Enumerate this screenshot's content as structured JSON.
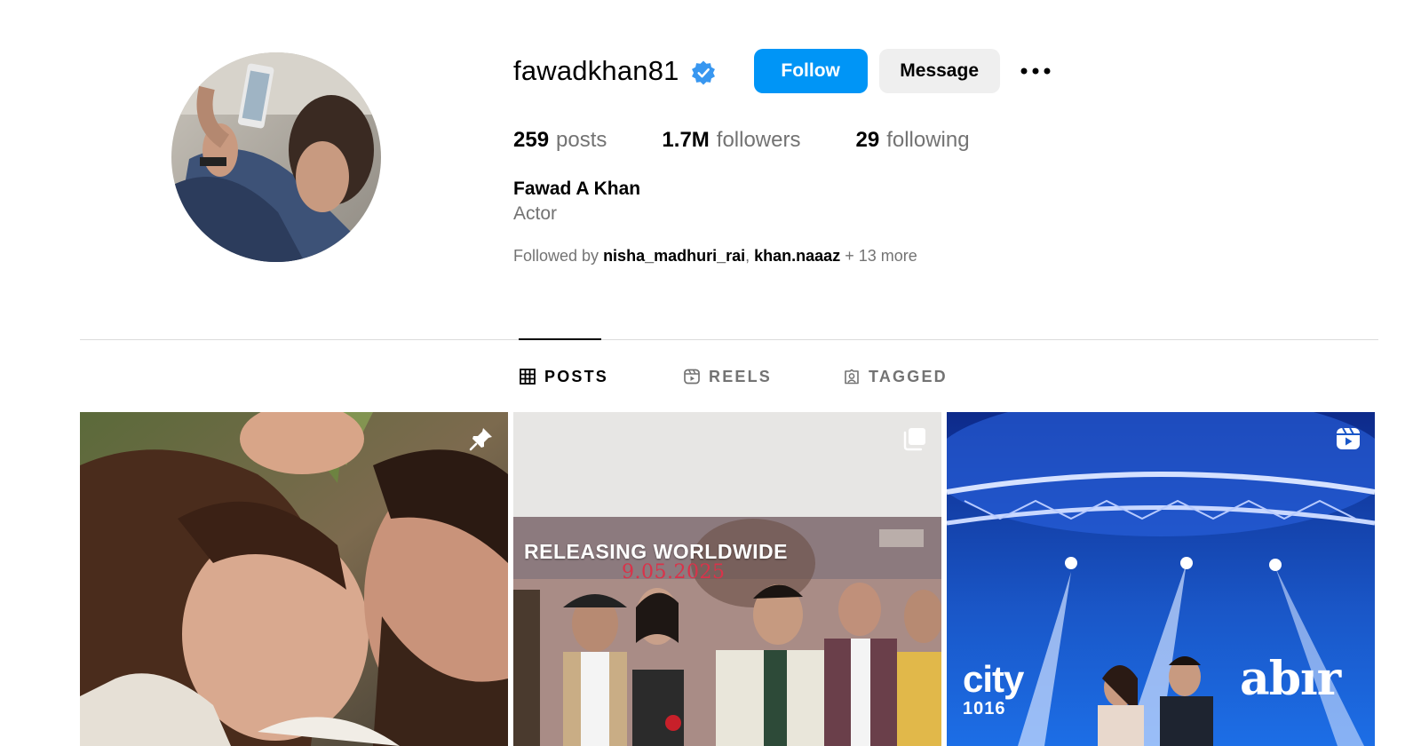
{
  "profile": {
    "username": "fawadkhan81",
    "verified": true,
    "follow_label": "Follow",
    "message_label": "Message",
    "stats": {
      "posts_count": "259",
      "posts_label": "posts",
      "followers_count": "1.7M",
      "followers_label": "followers",
      "following_count": "29",
      "following_label": "following"
    },
    "full_name": "Fawad A Khan",
    "category": "Actor",
    "followed_by": {
      "prefix": "Followed by",
      "user1": "nisha_madhuri_rai",
      "separator": ",",
      "user2": "khan.naaaz",
      "more": "+ 13 more"
    }
  },
  "tabs": [
    {
      "label": "POSTS",
      "icon": "grid-icon",
      "active": true
    },
    {
      "label": "REELS",
      "icon": "reels-icon",
      "active": false
    },
    {
      "label": "TAGGED",
      "icon": "tagged-icon",
      "active": false
    }
  ],
  "posts": [
    {
      "badge": "pin-icon"
    },
    {
      "badge": "carousel-icon",
      "poster_text": "RELEASING WORLDWIDE",
      "poster_date": "9.05.2025"
    },
    {
      "badge": "reel-icon",
      "logo_main": "city",
      "logo_sub": "1016",
      "show_title": "abır"
    }
  ],
  "colors": {
    "accent": "#0095f6",
    "secondary_button": "#efefef",
    "muted_text": "#737373",
    "divider": "#dbdbdb",
    "verified_badge": "#3897f0"
  }
}
